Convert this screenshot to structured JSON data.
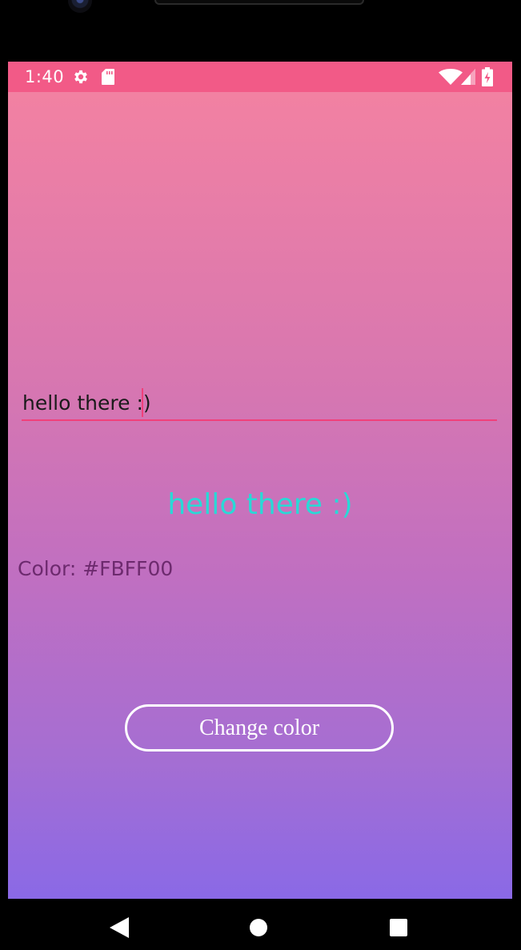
{
  "status_bar": {
    "time": "1:40",
    "icons": [
      "gear-icon",
      "sd-card-icon",
      "wifi-icon",
      "signal-icon",
      "battery-charging-icon"
    ],
    "background": "#f25a87"
  },
  "main": {
    "input_value": "hello there :)",
    "echo_text": "hello there :)",
    "echo_color": "#29d9d6",
    "color_label": "Color: #FBFF00",
    "change_color_label": "Change color",
    "gradient": [
      "#f281a2",
      "#8a69e6"
    ]
  },
  "navigation": {
    "icons": [
      "back-icon",
      "home-icon",
      "recents-icon"
    ]
  }
}
